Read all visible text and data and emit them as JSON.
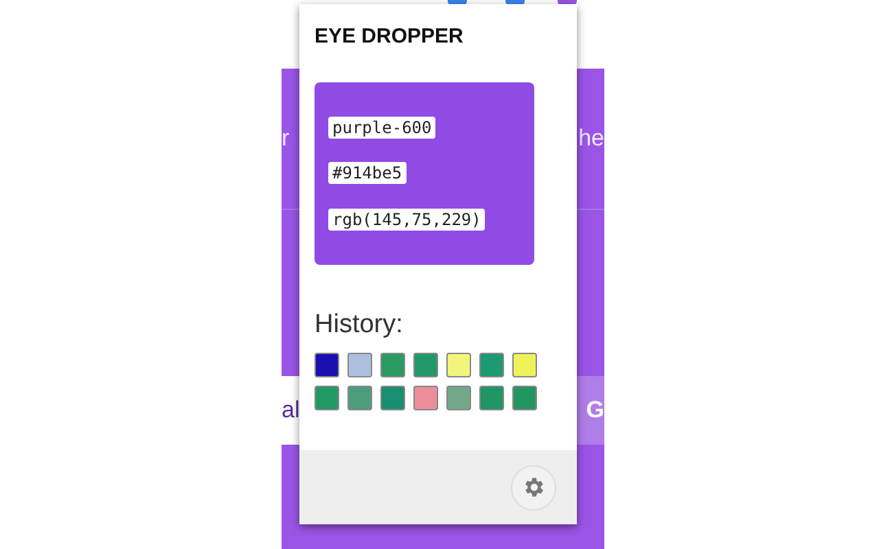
{
  "background_page": {
    "texts_top": [
      "r",
      "he"
    ],
    "texts_bottom": [
      "al",
      "G"
    ]
  },
  "popup": {
    "title": "EYE DROPPER",
    "color": {
      "color": "#914be5",
      "labels": [
        "purple-600",
        "#914be5",
        "rgb(145,75,229)"
      ]
    },
    "history_label": "History:",
    "history": [
      {
        "color": "#1a0fb0"
      },
      {
        "color": "#adc0e0"
      },
      {
        "color": "#2a9a63"
      },
      {
        "color": "#229868"
      },
      {
        "color": "#f2f57a"
      },
      {
        "color": "#1c9a72"
      },
      {
        "color": "#f0f25a"
      },
      {
        "color": "#219a63"
      },
      {
        "color": "#4a9e7c"
      },
      {
        "color": "#178f70"
      },
      {
        "color": "#ee8e9a"
      },
      {
        "color": "#74a88a"
      },
      {
        "color": "#1f9663"
      },
      {
        "color": "#23965f"
      }
    ]
  }
}
